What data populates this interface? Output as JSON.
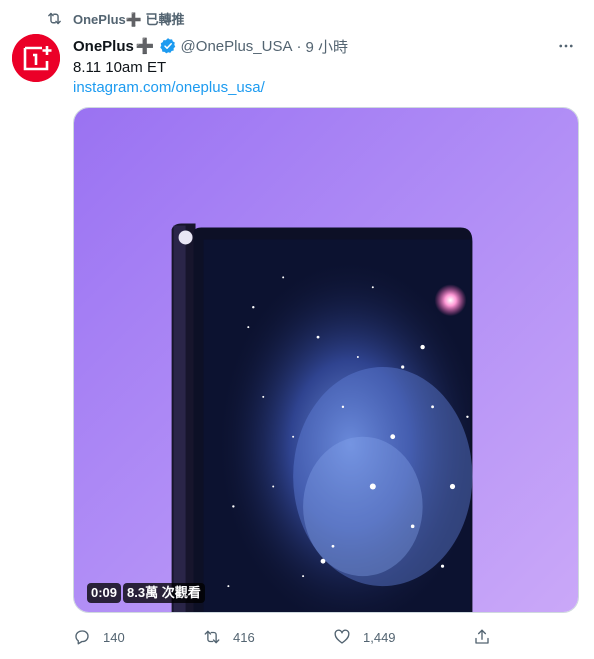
{
  "retweet": {
    "label": "OnePlus➕ 已轉推"
  },
  "author": {
    "name": "OnePlus",
    "name_suffix": "➕",
    "handle": "@OnePlus_USA",
    "separator": "·",
    "time": "9 小時",
    "verified": true
  },
  "tweet": {
    "text": "8.11 10am ET",
    "link": "instagram.com/oneplus_usa/"
  },
  "media": {
    "duration": "0:09",
    "views": "8.3萬 次觀看"
  },
  "actions": {
    "replies": "140",
    "retweets": "416",
    "likes": "1,449"
  },
  "colors": {
    "brand": "#eb0028",
    "accent": "#1d9bf0",
    "muted": "#536471"
  },
  "icons": [
    "retweet-icon",
    "oneplus-logo",
    "verified-badge-icon",
    "more-icon",
    "reply-icon",
    "retweet-icon",
    "like-icon",
    "share-icon"
  ]
}
